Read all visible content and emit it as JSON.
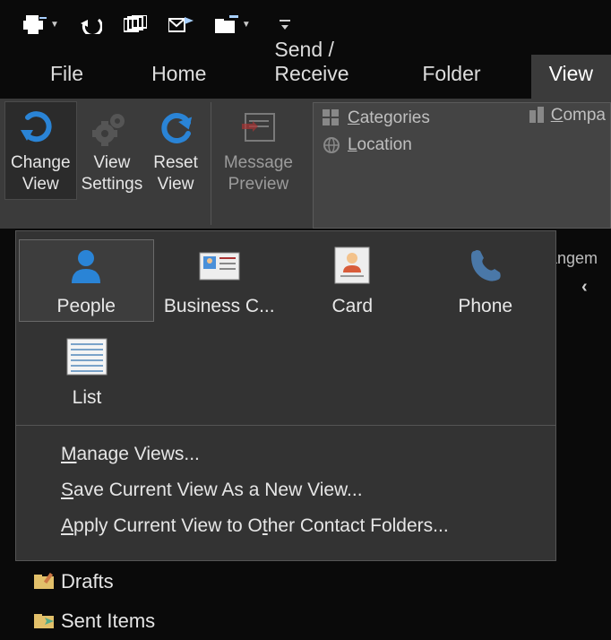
{
  "qat": {
    "items": [
      "print-dd",
      "undo",
      "windows",
      "forward-mail",
      "archive-dd",
      "customize-dd"
    ]
  },
  "tabs": {
    "file": "File",
    "home": "Home",
    "sendrecv": "Send / Receive",
    "folder": "Folder",
    "view": "View"
  },
  "ribbon": {
    "change_view": "Change\nView",
    "view_settings": "View\nSettings",
    "reset_view": "Reset\nView",
    "message_preview": "Message\nPreview",
    "categories": "Categories",
    "company": "Compa",
    "location": "Location"
  },
  "dropdown": {
    "people": "People",
    "business": "Business C...",
    "card": "Card",
    "phone": "Phone",
    "list": "List",
    "manage": "Manage Views...",
    "save": "Save Current View As a New View...",
    "apply": "Apply Current View to Other Contact Folders..."
  },
  "side": {
    "arrangement": "rangem"
  },
  "folders": {
    "drafts": "Drafts",
    "sent": "Sent Items"
  }
}
